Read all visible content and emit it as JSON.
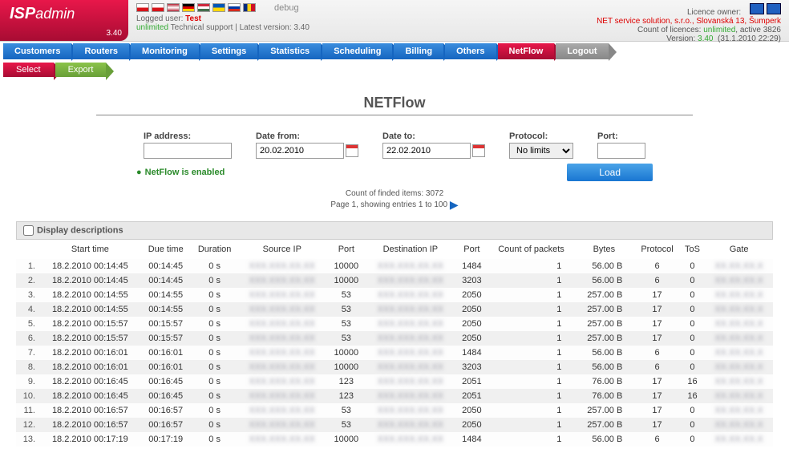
{
  "logo": {
    "brand": "ISP",
    "suffix": "admin",
    "version": "3.40"
  },
  "header": {
    "debug": "debug",
    "logged_label": "Logged user:",
    "logged_user": "Test",
    "support": "unlimited",
    "support_label": "Technical support | Latest version: 3.40",
    "licence_label": "Licence owner:",
    "licence_owner": "NET service solution, s.r.o., Slovanská 13, Šumperk",
    "count_label": "Count of licences:",
    "count_val": "unlimited",
    "active": ", active 3826",
    "version_label": "Version:",
    "version_val": "3.40",
    "timestamp": "(31.1.2010 22:29)"
  },
  "nav": [
    "Customers",
    "Routers",
    "Monitoring",
    "Settings",
    "Statistics",
    "Scheduling",
    "Billing",
    "Others",
    "NetFlow",
    "Logout"
  ],
  "subnav": [
    "Select",
    "Export"
  ],
  "page": {
    "title": "NETFlow",
    "ip_label": "IP address:",
    "date_from_label": "Date from:",
    "date_from": "20.02.2010",
    "date_to_label": "Date to:",
    "date_to": "22.02.2010",
    "protocol_label": "Protocol:",
    "protocol_val": "No limits",
    "port_label": "Port:",
    "enabled": "NetFlow is enabled",
    "load": "Load",
    "count_info": "Count of finded items: 3072",
    "page_info": "Page 1, showing entries 1 to 100",
    "display_desc": "Display descriptions"
  },
  "columns": [
    "Start time",
    "Due time",
    "Duration",
    "Source IP",
    "Port",
    "Destination IP",
    "Port",
    "Count of packets",
    "Bytes",
    "Protocol",
    "ToS",
    "Gate"
  ],
  "rows": [
    {
      "n": "1.",
      "start": "18.2.2010 00:14:45",
      "due": "00:14:45",
      "dur": "0 s",
      "sport": "10000",
      "dport": "1484",
      "pkts": "1",
      "bytes": "56.00 B",
      "proto": "6",
      "tos": "0"
    },
    {
      "n": "2.",
      "start": "18.2.2010 00:14:45",
      "due": "00:14:45",
      "dur": "0 s",
      "sport": "10000",
      "dport": "3203",
      "pkts": "1",
      "bytes": "56.00 B",
      "proto": "6",
      "tos": "0"
    },
    {
      "n": "3.",
      "start": "18.2.2010 00:14:55",
      "due": "00:14:55",
      "dur": "0 s",
      "sport": "53",
      "dport": "2050",
      "pkts": "1",
      "bytes": "257.00 B",
      "proto": "17",
      "tos": "0"
    },
    {
      "n": "4.",
      "start": "18.2.2010 00:14:55",
      "due": "00:14:55",
      "dur": "0 s",
      "sport": "53",
      "dport": "2050",
      "pkts": "1",
      "bytes": "257.00 B",
      "proto": "17",
      "tos": "0"
    },
    {
      "n": "5.",
      "start": "18.2.2010 00:15:57",
      "due": "00:15:57",
      "dur": "0 s",
      "sport": "53",
      "dport": "2050",
      "pkts": "1",
      "bytes": "257.00 B",
      "proto": "17",
      "tos": "0"
    },
    {
      "n": "6.",
      "start": "18.2.2010 00:15:57",
      "due": "00:15:57",
      "dur": "0 s",
      "sport": "53",
      "dport": "2050",
      "pkts": "1",
      "bytes": "257.00 B",
      "proto": "17",
      "tos": "0"
    },
    {
      "n": "7.",
      "start": "18.2.2010 00:16:01",
      "due": "00:16:01",
      "dur": "0 s",
      "sport": "10000",
      "dport": "1484",
      "pkts": "1",
      "bytes": "56.00 B",
      "proto": "6",
      "tos": "0"
    },
    {
      "n": "8.",
      "start": "18.2.2010 00:16:01",
      "due": "00:16:01",
      "dur": "0 s",
      "sport": "10000",
      "dport": "3203",
      "pkts": "1",
      "bytes": "56.00 B",
      "proto": "6",
      "tos": "0"
    },
    {
      "n": "9.",
      "start": "18.2.2010 00:16:45",
      "due": "00:16:45",
      "dur": "0 s",
      "sport": "123",
      "dport": "2051",
      "pkts": "1",
      "bytes": "76.00 B",
      "proto": "17",
      "tos": "16"
    },
    {
      "n": "10.",
      "start": "18.2.2010 00:16:45",
      "due": "00:16:45",
      "dur": "0 s",
      "sport": "123",
      "dport": "2051",
      "pkts": "1",
      "bytes": "76.00 B",
      "proto": "17",
      "tos": "16"
    },
    {
      "n": "11.",
      "start": "18.2.2010 00:16:57",
      "due": "00:16:57",
      "dur": "0 s",
      "sport": "53",
      "dport": "2050",
      "pkts": "1",
      "bytes": "257.00 B",
      "proto": "17",
      "tos": "0"
    },
    {
      "n": "12.",
      "start": "18.2.2010 00:16:57",
      "due": "00:16:57",
      "dur": "0 s",
      "sport": "53",
      "dport": "2050",
      "pkts": "1",
      "bytes": "257.00 B",
      "proto": "17",
      "tos": "0"
    },
    {
      "n": "13.",
      "start": "18.2.2010 00:17:19",
      "due": "00:17:19",
      "dur": "0 s",
      "sport": "10000",
      "dport": "1484",
      "pkts": "1",
      "bytes": "56.00 B",
      "proto": "6",
      "tos": "0"
    }
  ]
}
